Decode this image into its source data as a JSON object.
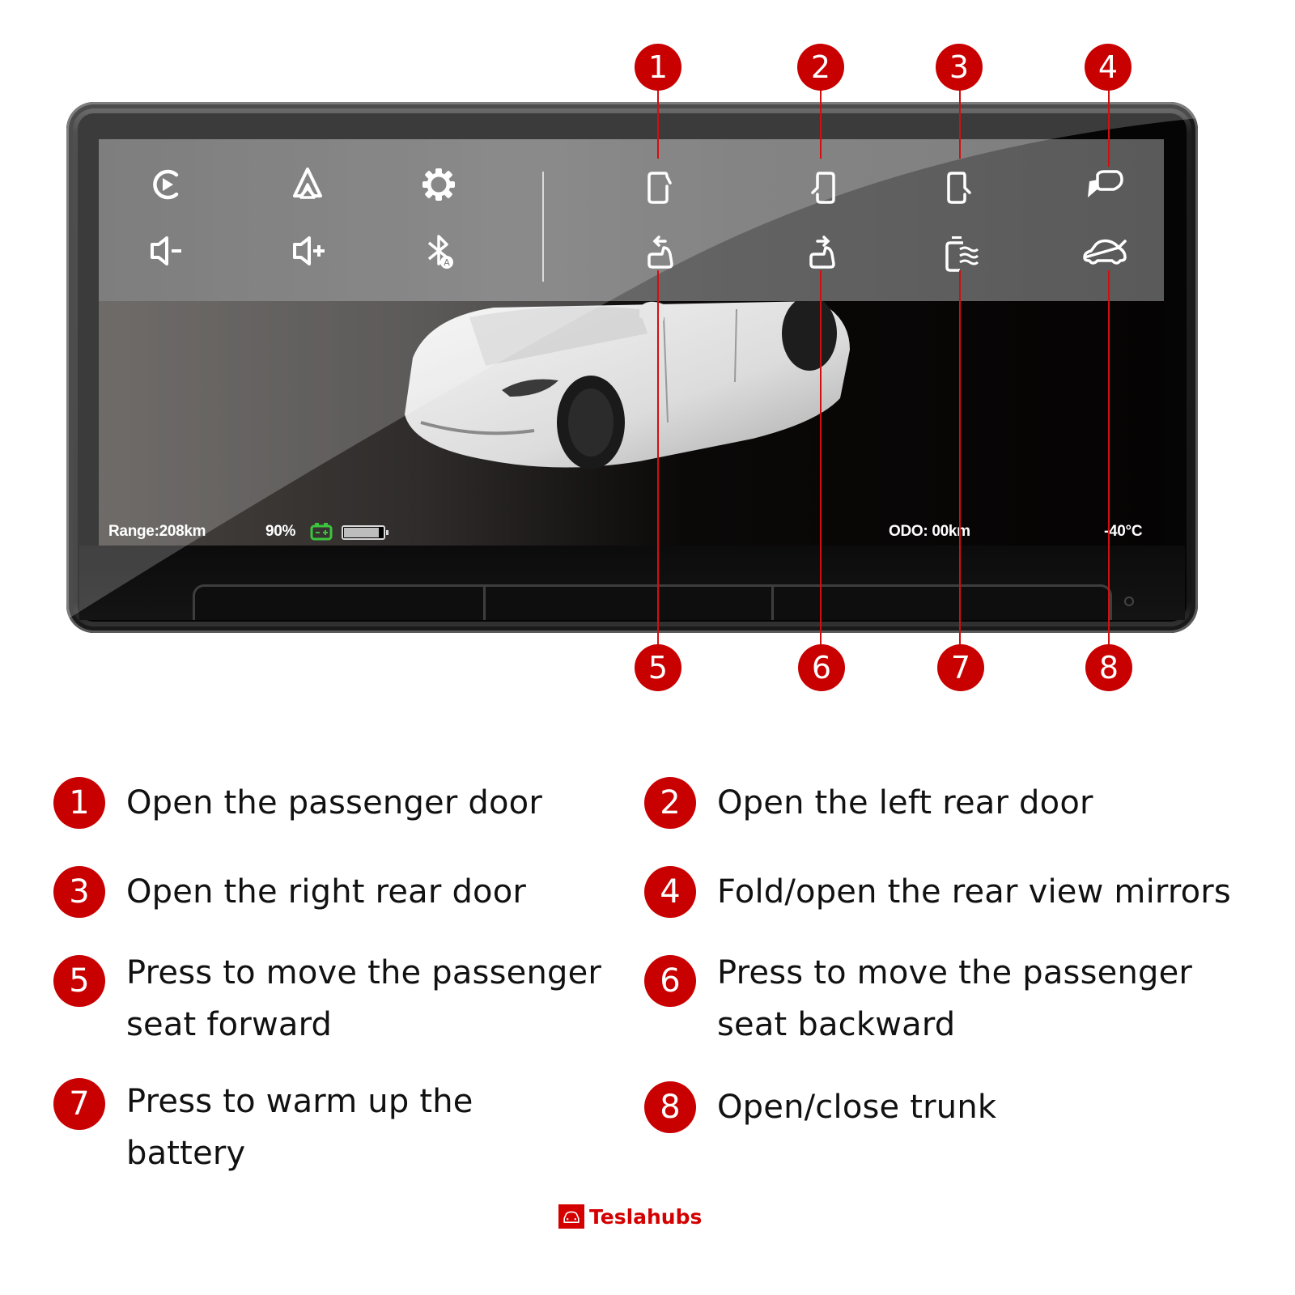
{
  "callouts": {
    "top": [
      "1",
      "2",
      "3",
      "4"
    ],
    "bottom": [
      "5",
      "6",
      "7",
      "8"
    ]
  },
  "screen": {
    "left_icons": [
      {
        "name": "carplay-icon"
      },
      {
        "name": "android-auto-icon"
      },
      {
        "name": "settings-gear-icon"
      },
      {
        "name": "volume-down-icon"
      },
      {
        "name": "volume-up-icon"
      },
      {
        "name": "bluetooth-auto-icon"
      }
    ],
    "right_icons": [
      {
        "name": "passenger-door-icon",
        "callout": "1"
      },
      {
        "name": "left-rear-door-icon",
        "callout": "2"
      },
      {
        "name": "right-rear-door-icon",
        "callout": "3"
      },
      {
        "name": "mirror-fold-icon",
        "callout": "4"
      },
      {
        "name": "seat-forward-icon",
        "callout": "5"
      },
      {
        "name": "seat-backward-icon",
        "callout": "6"
      },
      {
        "name": "battery-heat-icon",
        "callout": "7"
      },
      {
        "name": "trunk-icon",
        "callout": "8"
      }
    ],
    "status": {
      "range": "Range:208km",
      "battery_percent": "90%",
      "battery_level": 0.9,
      "odo": "ODO: 00km",
      "temperature": "-40°C"
    },
    "colors": {
      "battery_icon": "#3cc43c",
      "accent": "#c80000"
    }
  },
  "legend": [
    {
      "num": "1",
      "text": "Open the passenger door"
    },
    {
      "num": "2",
      "text": "Open the left rear door"
    },
    {
      "num": "3",
      "text": "Open the right rear door"
    },
    {
      "num": "4",
      "text": "Fold/open the rear view mirrors"
    },
    {
      "num": "5",
      "line1": "Press to move the passenger",
      "line2": "seat forward"
    },
    {
      "num": "6",
      "line1": "Press to move the passenger",
      "line2": "seat backward"
    },
    {
      "num": "7",
      "line1": "Press to warm up the",
      "line2": "battery"
    },
    {
      "num": "8",
      "text": "Open/close trunk"
    }
  ],
  "brand": {
    "name": "Teslahubs"
  }
}
